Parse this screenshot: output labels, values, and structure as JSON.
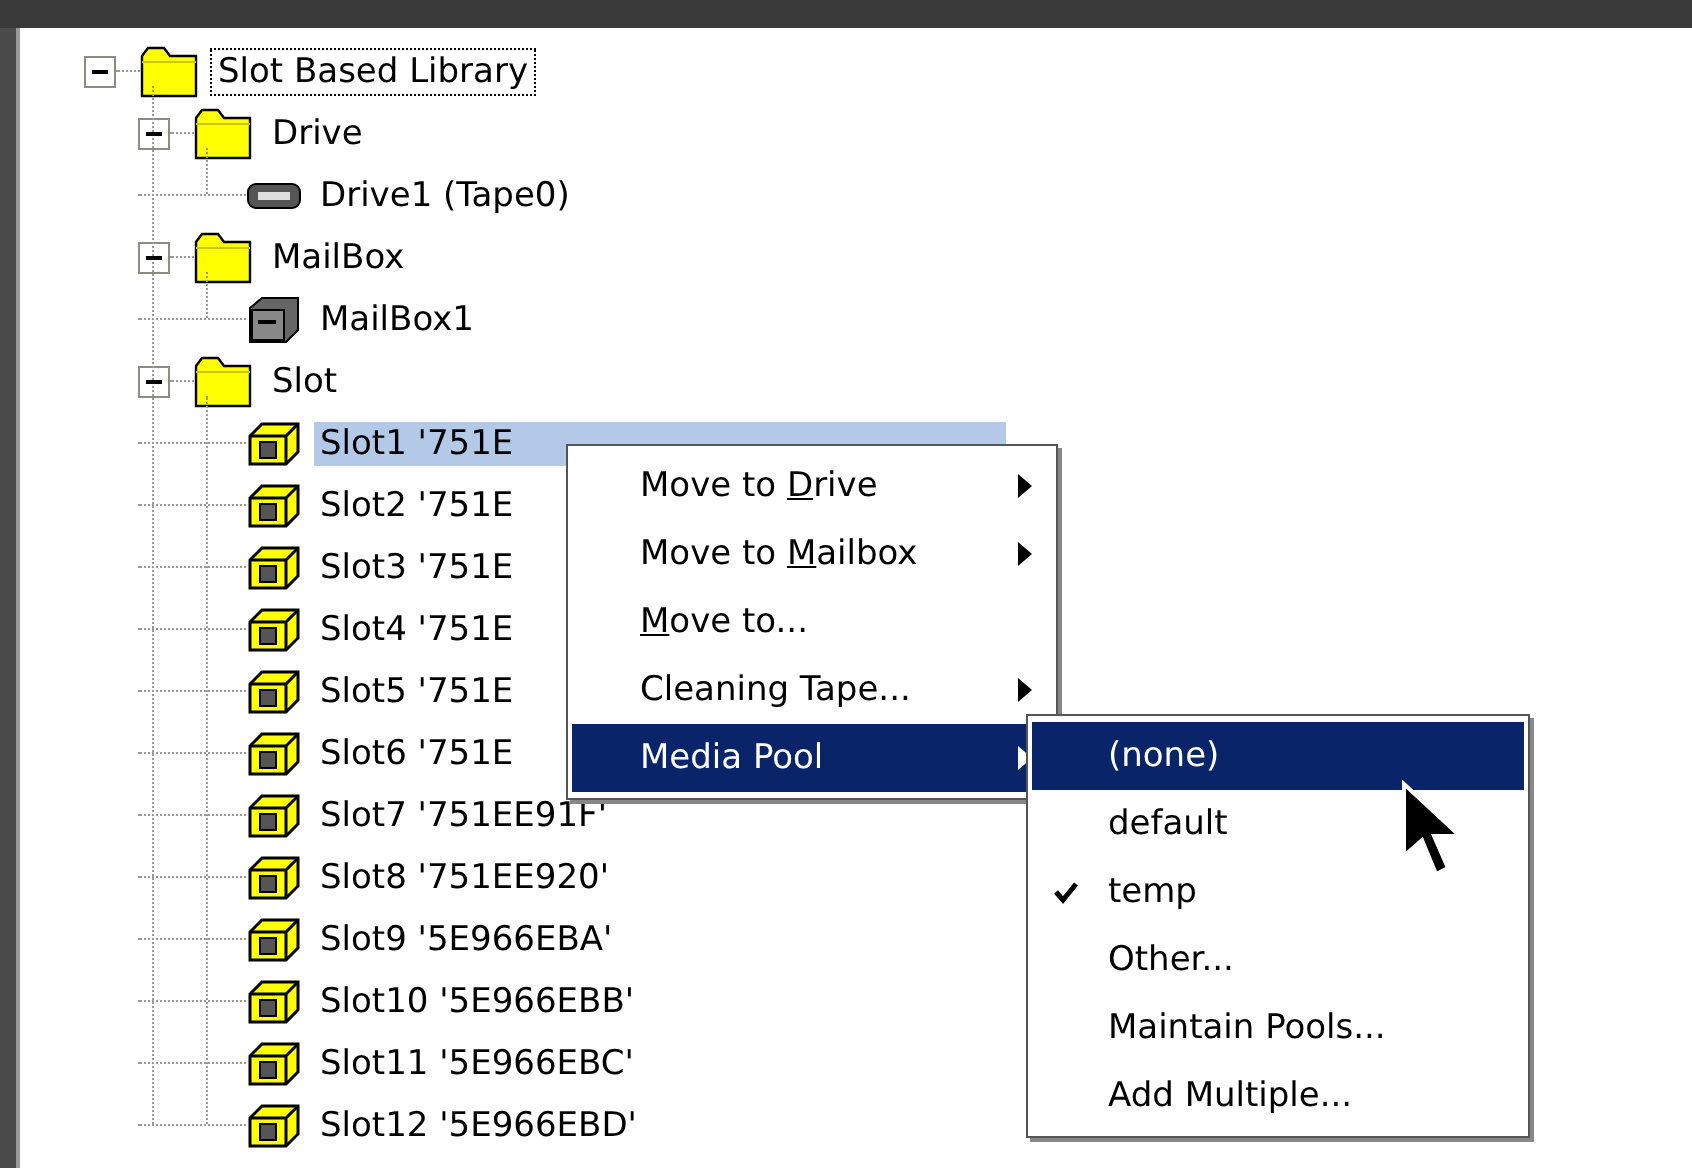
{
  "tree": [
    {
      "label": "Slot Based Library",
      "kind": "folder",
      "expanded": true,
      "focused": true,
      "selected": false,
      "children": [
        {
          "label": "Drive",
          "kind": "folder",
          "expanded": true,
          "selected": false,
          "children": [
            {
              "label": "Drive1 (Tape0)",
              "kind": "drive",
              "selected": false
            }
          ]
        },
        {
          "label": "MailBox",
          "kind": "folder",
          "expanded": true,
          "selected": false,
          "children": [
            {
              "label": "MailBox1",
              "kind": "mailbox",
              "selected": false
            }
          ]
        },
        {
          "label": "Slot",
          "kind": "folder",
          "expanded": true,
          "selected": false,
          "children": [
            {
              "label": "Slot1 '751E",
              "kind": "slot",
              "selected": true
            },
            {
              "label": "Slot2 '751E",
              "kind": "slot",
              "selected": false
            },
            {
              "label": "Slot3 '751E",
              "kind": "slot",
              "selected": false
            },
            {
              "label": "Slot4 '751E",
              "kind": "slot",
              "selected": false
            },
            {
              "label": "Slot5 '751E",
              "kind": "slot",
              "selected": false
            },
            {
              "label": "Slot6 '751E",
              "kind": "slot",
              "selected": false
            },
            {
              "label": "Slot7 '751EE91F'",
              "kind": "slot",
              "selected": false
            },
            {
              "label": "Slot8 '751EE920'",
              "kind": "slot",
              "selected": false
            },
            {
              "label": "Slot9 '5E966EBA'",
              "kind": "slot",
              "selected": false
            },
            {
              "label": "Slot10 '5E966EBB'",
              "kind": "slot",
              "selected": false
            },
            {
              "label": "Slot11 '5E966EBC'",
              "kind": "slot",
              "selected": false
            },
            {
              "label": "Slot12 '5E966EBD'",
              "kind": "slot",
              "selected": false
            }
          ]
        }
      ]
    }
  ],
  "context_menu": {
    "items": [
      {
        "label_parts": [
          {
            "text": "Move to ",
            "underline": false
          },
          {
            "text": "D",
            "underline": true
          },
          {
            "text": "rive",
            "underline": false
          }
        ],
        "submenu": true,
        "selected": false
      },
      {
        "label_parts": [
          {
            "text": "Move to ",
            "underline": false
          },
          {
            "text": "M",
            "underline": true
          },
          {
            "text": "ailbox",
            "underline": false
          }
        ],
        "submenu": true,
        "selected": false
      },
      {
        "label_parts": [
          {
            "text": "M",
            "underline": true
          },
          {
            "text": "ove to...",
            "underline": false
          }
        ],
        "submenu": false,
        "selected": false
      },
      {
        "label_parts": [
          {
            "text": "Cleaning Tape...",
            "underline": false
          }
        ],
        "submenu": true,
        "selected": false
      },
      {
        "label_parts": [
          {
            "text": "Media Pool",
            "underline": false
          }
        ],
        "submenu": true,
        "selected": true
      }
    ]
  },
  "submenu": {
    "items": [
      {
        "label": "(none)",
        "checked": false,
        "selected": true
      },
      {
        "label": "default",
        "checked": false,
        "selected": false
      },
      {
        "label": "temp",
        "checked": true,
        "selected": false
      },
      {
        "label": "Other...",
        "checked": false,
        "selected": false
      },
      {
        "label": "Maintain Pools...",
        "checked": false,
        "selected": false
      },
      {
        "label": "Add Multiple...",
        "checked": false,
        "selected": false
      }
    ]
  }
}
